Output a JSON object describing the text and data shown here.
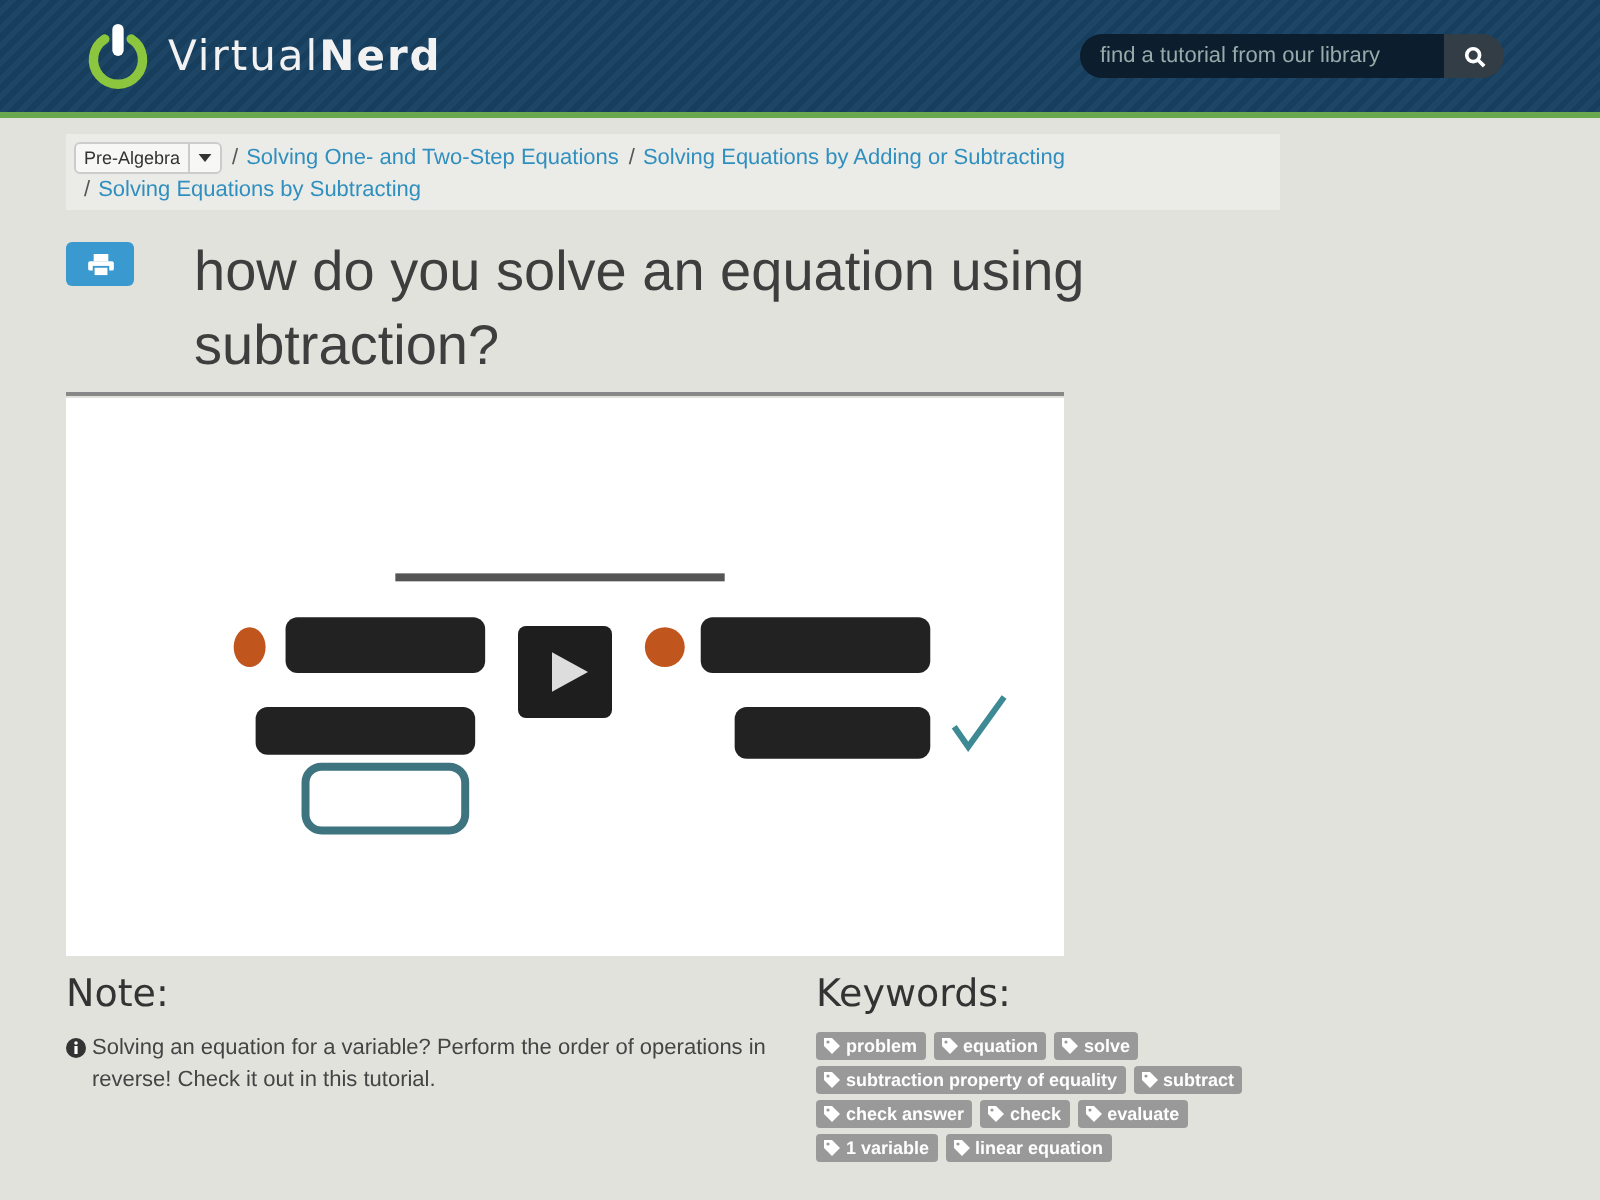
{
  "header": {
    "logo": {
      "light": "Virtual",
      "bold": "Nerd"
    },
    "search": {
      "placeholder": "find a tutorial from our library"
    }
  },
  "breadcrumb": {
    "subject": "Pre-Algebra",
    "links": [
      {
        "separator": "/",
        "label": "Solving One- and Two-Step Equations"
      },
      {
        "separator": "/",
        "label": "Solving Equations by Adding or Subtracting"
      },
      {
        "separator": "/",
        "label": "Solving Equations by Subtracting"
      }
    ]
  },
  "title": "how do you solve an equation using subtraction?",
  "note": {
    "heading": "Note:",
    "text": "Solving an equation for a variable? Perform the order of operations in reverse! Check it out in this tutorial."
  },
  "keywords": {
    "heading": "Keywords:",
    "tags": [
      "problem",
      "equation",
      "solve",
      "subtraction property of equality",
      "subtract",
      "check answer",
      "check",
      "evaluate",
      "1 variable",
      "linear equation"
    ]
  }
}
